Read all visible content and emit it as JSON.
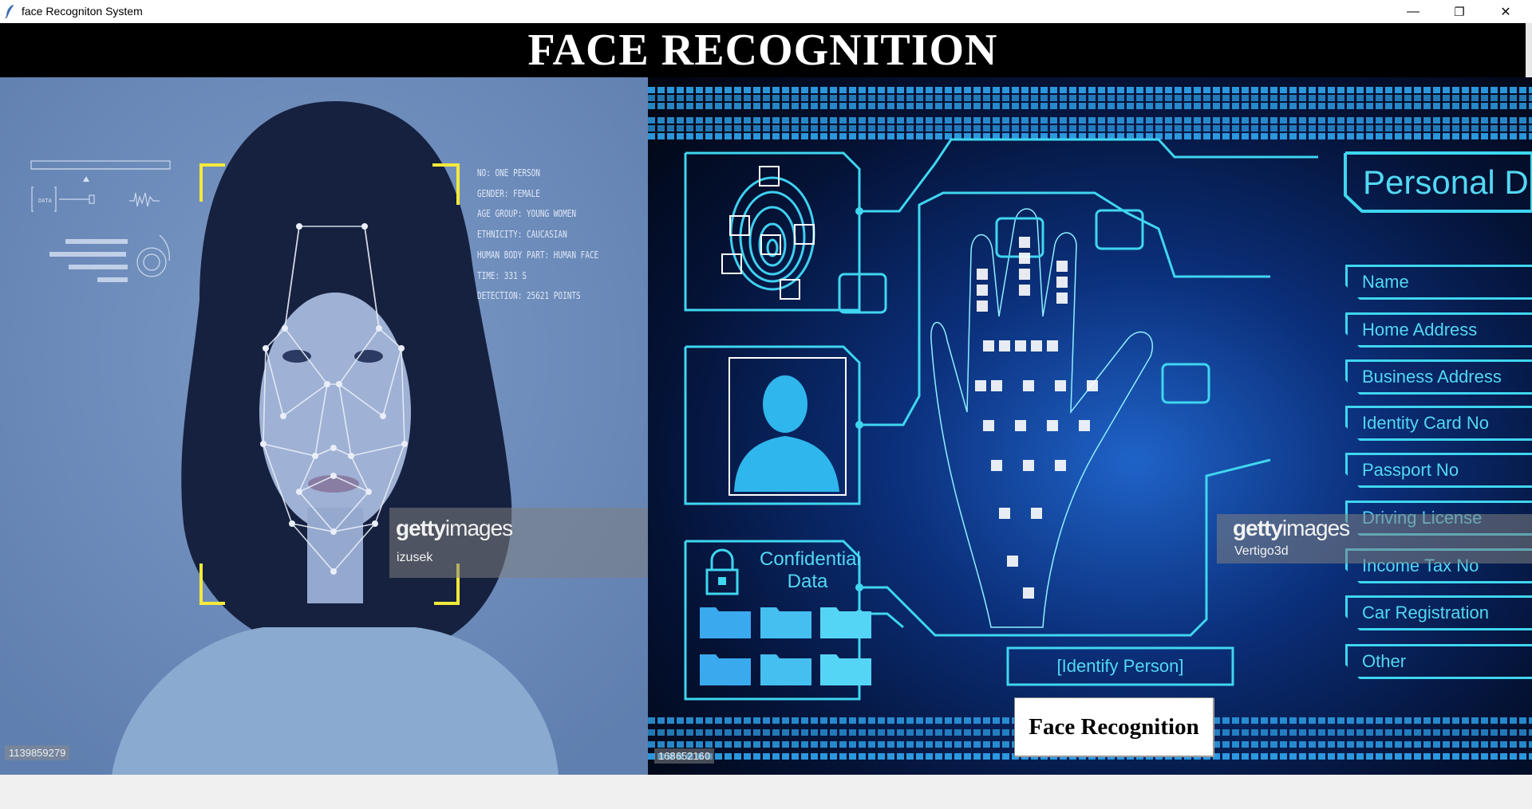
{
  "window": {
    "title": "face Recogniton System",
    "icon": "feather-icon",
    "controls": {
      "minimize": "—",
      "maximize": "❐",
      "close": "✕"
    }
  },
  "header": {
    "title": "FACE RECOGNITION"
  },
  "left_image": {
    "description": "woman face with facial landmark mesh",
    "hud_lines": [
      "NO: ONE PERSON",
      "GENDER: FEMALE",
      "AGE GROUP: YOUNG WOMEN",
      "ETHNICITY: CAUCASIAN",
      "HUMAN BODY PART: HUMAN FACE",
      "TIME: 331 S",
      "DETECTION: 25621 POINTS"
    ],
    "hud_data_label": "DATA",
    "watermark": {
      "brand_bold": "getty",
      "brand_light": "images",
      "credit": "izusek"
    },
    "image_id": "1139859279",
    "accent_color": "#f4e93a"
  },
  "right_image": {
    "description": "biometric hand scan interface",
    "confidential": {
      "line1": "Confidential",
      "line2": "Data"
    },
    "identify_label": "[Identify Person]",
    "personal_data_title": "Personal D",
    "personal_data_items": [
      "Name",
      "Home Address",
      "Business Address",
      "Identity Card No",
      "Passport No",
      "Driving License",
      "Income Tax No",
      "Car Registration",
      "Other"
    ],
    "watermark": {
      "brand_bold": "getty",
      "brand_light": "images",
      "credit": "Vertigo3d"
    },
    "image_id": "168652160",
    "accent_color": "#3fd6f0"
  },
  "actions": {
    "face_recognition_button": "Face Recognition"
  }
}
